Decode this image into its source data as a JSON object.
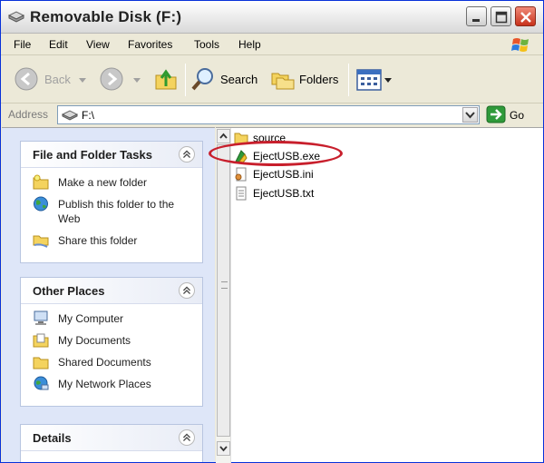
{
  "window": {
    "title": "Removable Disk (F:)"
  },
  "menu": {
    "items": [
      "File",
      "Edit",
      "View",
      "Favorites",
      "Tools",
      "Help"
    ]
  },
  "toolbar": {
    "back_label": "Back",
    "search_label": "Search",
    "folders_label": "Folders"
  },
  "address": {
    "label": "Address",
    "value": "F:\\",
    "go_label": "Go"
  },
  "panels": {
    "file_tasks": {
      "title": "File and Folder Tasks",
      "items": [
        "Make a new folder",
        "Publish this folder to the Web",
        "Share this folder"
      ]
    },
    "other_places": {
      "title": "Other Places",
      "items": [
        "My Computer",
        "My Documents",
        "Shared Documents",
        "My Network Places"
      ]
    },
    "details": {
      "title": "Details"
    }
  },
  "files": [
    {
      "name": "source",
      "icon": "folder-icon"
    },
    {
      "name": "EjectUSB.exe",
      "icon": "exe-icon"
    },
    {
      "name": "EjectUSB.ini",
      "icon": "ini-file-icon"
    },
    {
      "name": "EjectUSB.txt",
      "icon": "text-file-icon"
    }
  ],
  "colors": {
    "task_pane_bg": "#dee6f8",
    "highlight_ring": "#c81f2c",
    "toolbar_bg": "#ece9d8"
  }
}
